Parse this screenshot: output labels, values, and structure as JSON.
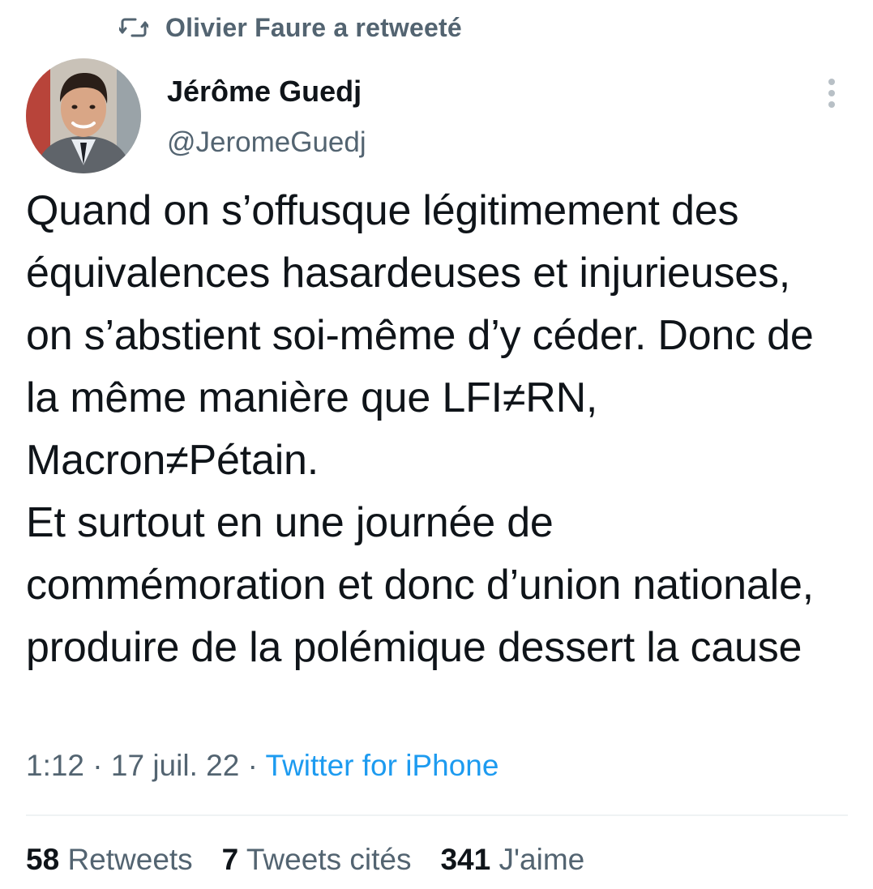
{
  "retweet_banner": {
    "text": "Olivier Faure a retweeté",
    "icon": "retweet-icon"
  },
  "author": {
    "display_name": "Jérôme Guedj",
    "handle": "@JeromeGuedj",
    "avatar_icon": "avatar-photo"
  },
  "more_icon": "more-vertical-icon",
  "tweet": {
    "text": "Quand on s’offusque légitimement des équivalences hasardeuses et injurieuses, on s’abstient soi-même d’y céder. Donc de la même manière que LFI≠RN, Macron≠Pétain.\nEt surtout en une journée de commémoration et donc d’union nationale, produire de la polémique dessert la cause"
  },
  "meta": {
    "time": "1:12",
    "separator": " · ",
    "date": "17 juil. 22",
    "source": "Twitter for iPhone"
  },
  "stats": {
    "retweets_count": "58",
    "retweets_label": "Retweets",
    "quotes_count": "7",
    "quotes_label": "Tweets cités",
    "likes_count": "341",
    "likes_label": "J'aime"
  },
  "colors": {
    "text_primary": "#0f1419",
    "text_secondary": "#536471",
    "link_blue": "#1d9bf0",
    "divider": "#eff3f4"
  }
}
